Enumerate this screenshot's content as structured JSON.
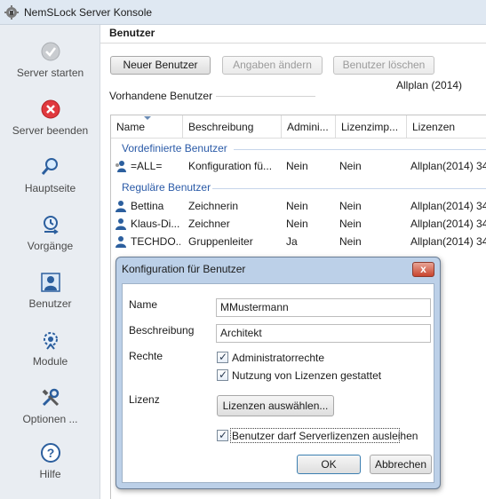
{
  "window": {
    "title": "NemSLock Server Konsole",
    "app_icon": "gear-lock-icon"
  },
  "sidebar": {
    "items": [
      {
        "label": "Server starten",
        "icon": "check-circle-icon"
      },
      {
        "label": "Server beenden",
        "icon": "stop-circle-icon"
      },
      {
        "label": "Hauptseite",
        "icon": "magnifier-icon"
      },
      {
        "label": "Vorgänge",
        "icon": "process-icon"
      },
      {
        "label": "Benutzer",
        "icon": "user-icon"
      },
      {
        "label": "Module",
        "icon": "module-icon"
      },
      {
        "label": "Optionen ...",
        "icon": "tools-icon"
      },
      {
        "label": "Hilfe",
        "icon": "help-icon"
      }
    ]
  },
  "main": {
    "heading": "Benutzer",
    "toolbar": {
      "new_user": "Neuer Benutzer",
      "edit": "Angaben ändern",
      "delete": "Benutzer löschen"
    },
    "section_label": "Vorhandene Benutzer",
    "license_info": "Allplan (2014)",
    "table": {
      "columns": [
        "Name",
        "Beschreibung",
        "Admini...",
        "Lizenzimp...",
        "Lizenzen"
      ],
      "groups": [
        {
          "label": "Vordefinierte Benutzer",
          "rows": [
            {
              "name": "=ALL=",
              "description": "Konfiguration fü...",
              "admin": "Nein",
              "import": "Nein",
              "licenses": "Allplan(2014) 34"
            }
          ]
        },
        {
          "label": "Reguläre Benutzer",
          "rows": [
            {
              "name": "Bettina",
              "description": "Zeichnerin",
              "admin": "Nein",
              "import": "Nein",
              "licenses": "Allplan(2014) 34"
            },
            {
              "name": "Klaus-Di...",
              "description": "Zeichner",
              "admin": "Nein",
              "import": "Nein",
              "licenses": "Allplan(2014) 34"
            },
            {
              "name": "TECHDO...",
              "description": "Gruppenleiter",
              "admin": "Ja",
              "import": "Nein",
              "licenses": "Allplan(2014) 34"
            }
          ]
        }
      ]
    }
  },
  "dialog": {
    "title": "Konfiguration für Benutzer",
    "close_glyph": "x",
    "name_label": "Name",
    "name_value": "MMustermann",
    "description_label": "Beschreibung",
    "description_value": "Architekt",
    "rights_label": "Rechte",
    "admin_rights": {
      "label": "Administratorrechte",
      "checked": true
    },
    "license_use": {
      "label": "Nutzung von Lizenzen gestattet",
      "checked": true
    },
    "license_label": "Lizenz",
    "select_licenses_button": "Lizenzen auswählen...",
    "borrow": {
      "label": "Benutzer darf Serverlizenzen ausleihen",
      "checked": true
    },
    "ok_button": "OK",
    "cancel_button": "Abbrechen"
  }
}
